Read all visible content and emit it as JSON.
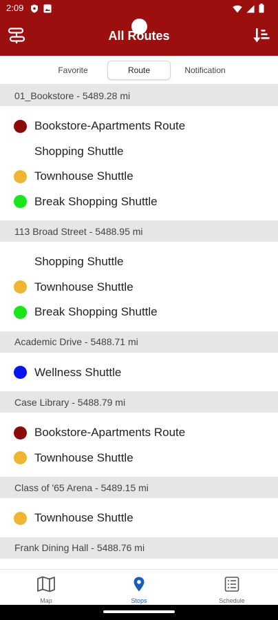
{
  "status_bar": {
    "time": "2:09"
  },
  "header": {
    "title": "All Routes",
    "left_icon": "route-toggle-icon",
    "right_icon": "sort-icon"
  },
  "tabs": [
    {
      "label": "Favorite",
      "selected": false
    },
    {
      "label": "Route",
      "selected": true
    },
    {
      "label": "Notification",
      "selected": false
    }
  ],
  "colors": {
    "brand": "#9b0f0f",
    "maroon": "#8b0a0a",
    "yellow": "#f0b432",
    "green": "#19e619",
    "blue": "#0a14ee",
    "active_nav": "#1a5fb4"
  },
  "stops": [
    {
      "header": "01_Bookstore - 5489.28 mi",
      "routes": [
        {
          "name": "Bookstore-Apartments Route",
          "color": "#8b0a0a"
        },
        {
          "name": "Shopping Shuttle",
          "color": ""
        },
        {
          "name": "Townhouse Shuttle",
          "color": "#f0b432"
        },
        {
          "name": "Break Shopping Shuttle",
          "color": "#19e619"
        }
      ]
    },
    {
      "header": "113 Broad Street - 5488.95 mi",
      "routes": [
        {
          "name": "Shopping Shuttle",
          "color": ""
        },
        {
          "name": "Townhouse Shuttle",
          "color": "#f0b432"
        },
        {
          "name": "Break Shopping Shuttle",
          "color": "#19e619"
        }
      ]
    },
    {
      "header": "Academic Drive - 5488.71 mi",
      "routes": [
        {
          "name": "Wellness Shuttle",
          "color": "#0a14ee"
        }
      ]
    },
    {
      "header": "Case Library - 5488.79 mi",
      "routes": [
        {
          "name": "Bookstore-Apartments Route",
          "color": "#8b0a0a"
        },
        {
          "name": "Townhouse Shuttle",
          "color": "#f0b432"
        }
      ]
    },
    {
      "header": "Class of '65 Arena - 5489.15 mi",
      "routes": [
        {
          "name": "Townhouse Shuttle",
          "color": "#f0b432"
        }
      ]
    },
    {
      "header": "Frank Dining Hall - 5488.76 mi",
      "routes": []
    }
  ],
  "bottom_nav": [
    {
      "label": "Map",
      "icon": "map-icon",
      "active": false
    },
    {
      "label": "Stops",
      "icon": "location-pin-icon",
      "active": true
    },
    {
      "label": "Schedule",
      "icon": "schedule-icon",
      "active": false
    }
  ]
}
